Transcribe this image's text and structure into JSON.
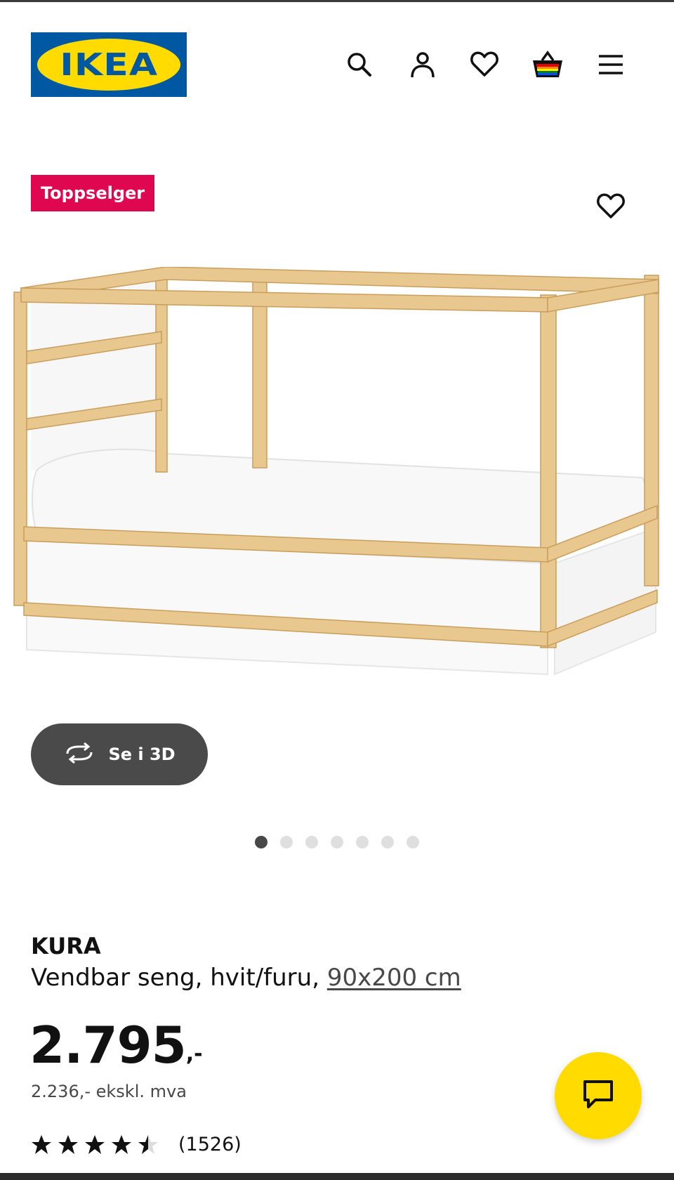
{
  "header": {
    "logo_text": "IKEA",
    "icons": [
      "search-icon",
      "account-icon",
      "heart-icon",
      "basket-icon",
      "menu-icon"
    ]
  },
  "product": {
    "badge": "Toppselger",
    "name": "KURA",
    "description": "Vendbar seng, hvit/furu,",
    "size": "90x200 cm",
    "price_main": "2.795",
    "price_suffix": ",-",
    "price_ex_vat": "2.236,- ekskl. mva",
    "rating_value": 4.5,
    "review_count": "(1526)"
  },
  "gallery": {
    "view_3d_label": "Se i 3D",
    "dot_count": 7,
    "active_dot": 0
  },
  "colors": {
    "ikea_blue": "#0058a3",
    "ikea_yellow": "#ffdb00",
    "badge_red": "#e00751",
    "button_dark": "#4a4a4a"
  }
}
